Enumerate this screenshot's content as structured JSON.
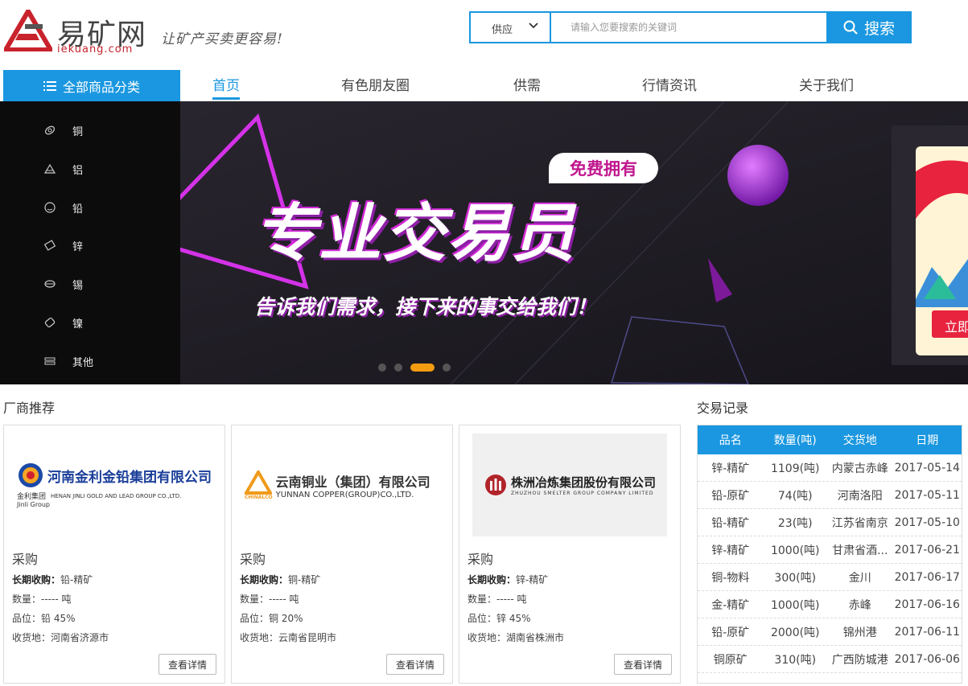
{
  "brand": {
    "name_cn": "易矿网",
    "name_en": "iekuang.com",
    "slogan": "让矿产买卖更容易!"
  },
  "search": {
    "category_value": "供应",
    "placeholder": "请输入您要搜索的关键词",
    "button_label": "搜索"
  },
  "nav": {
    "category_button": "全部商品分类",
    "items": [
      "首页",
      "有色朋友圈",
      "供需",
      "行情资讯",
      "关于我们"
    ],
    "active_index": 0
  },
  "sidebar": {
    "items": [
      {
        "label": "铜",
        "icon": "copper-icon"
      },
      {
        "label": "铝",
        "icon": "aluminum-icon"
      },
      {
        "label": "铅",
        "icon": "lead-icon"
      },
      {
        "label": "锌",
        "icon": "zinc-icon"
      },
      {
        "label": "锡",
        "icon": "tin-icon"
      },
      {
        "label": "镍",
        "icon": "nickel-icon"
      },
      {
        "label": "其他",
        "icon": "other-icon"
      }
    ]
  },
  "banner": {
    "tag": "免费拥有",
    "title": "专业交易员",
    "subtitle": "告诉我们需求，接下来的事交给我们！",
    "side_button": "立即",
    "slides": 4,
    "active_slide": 2
  },
  "vendors": {
    "title": "厂商推荐",
    "cards": [
      {
        "logo_cn": "河南金利金铅集团有限公司",
        "logo_en": "HENAN JINLI GOLD AND LEAD GROUP CO.,LTD.",
        "logo_sub": "金利集团",
        "logo_sub_en": "Jinli Group",
        "type": "采购",
        "purchase_label": "长期收购：",
        "purchase_value": "铅-精矿",
        "quantity": "数量：----- 吨",
        "grade": "品位：铅 45%",
        "location": "收货地：河南省济源市",
        "button": "查看详情"
      },
      {
        "logo_cn": "云南铜业（集团）有限公司",
        "logo_en": "YUNNAN COPPER(GROUP)CO.,LTD.",
        "logo_sub": "CHINALCO",
        "type": "采购",
        "purchase_label": "长期收购：",
        "purchase_value": "铜-精矿",
        "quantity": "数量：----- 吨",
        "grade": "品位：铜 20%",
        "location": "收货地：云南省昆明市",
        "button": "查看详情"
      },
      {
        "logo_cn": "株洲冶炼集团股份有限公司",
        "logo_en": "ZHUZHOU SMELTER GROUP COMPANY LIMITED",
        "type": "采购",
        "purchase_label": "长期收购：",
        "purchase_value": "锌-精矿",
        "quantity": "数量：----- 吨",
        "grade": "品位：锌 45%",
        "location": "收货地：湖南省株洲市",
        "button": "查看详情"
      }
    ]
  },
  "trades": {
    "title": "交易记录",
    "headers": [
      "品名",
      "数量(吨)",
      "交货地",
      "日期"
    ],
    "rows": [
      [
        "锌-精矿",
        "1109(吨)",
        "内蒙古赤峰",
        "2017-05-14"
      ],
      [
        "铅-原矿",
        "74(吨)",
        "河南洛阳",
        "2017-05-11"
      ],
      [
        "铅-精矿",
        "23(吨)",
        "江苏省南京",
        "2017-05-10"
      ],
      [
        "锌-精矿",
        "1000(吨)",
        "甘肃省酒...",
        "2017-06-21"
      ],
      [
        "铜-物料",
        "300(吨)",
        "金川",
        "2017-06-17"
      ],
      [
        "金-精矿",
        "1000(吨)",
        "赤峰",
        "2017-06-16"
      ],
      [
        "铅-原矿",
        "2000(吨)",
        "锦州港",
        "2017-06-11"
      ],
      [
        "铜原矿",
        "310(吨)",
        "广西防城港",
        "2017-06-06"
      ]
    ]
  },
  "colors": {
    "accent": "#1a97e0",
    "brand_red": "#c8232c",
    "banner_magenta": "#c0178e"
  }
}
